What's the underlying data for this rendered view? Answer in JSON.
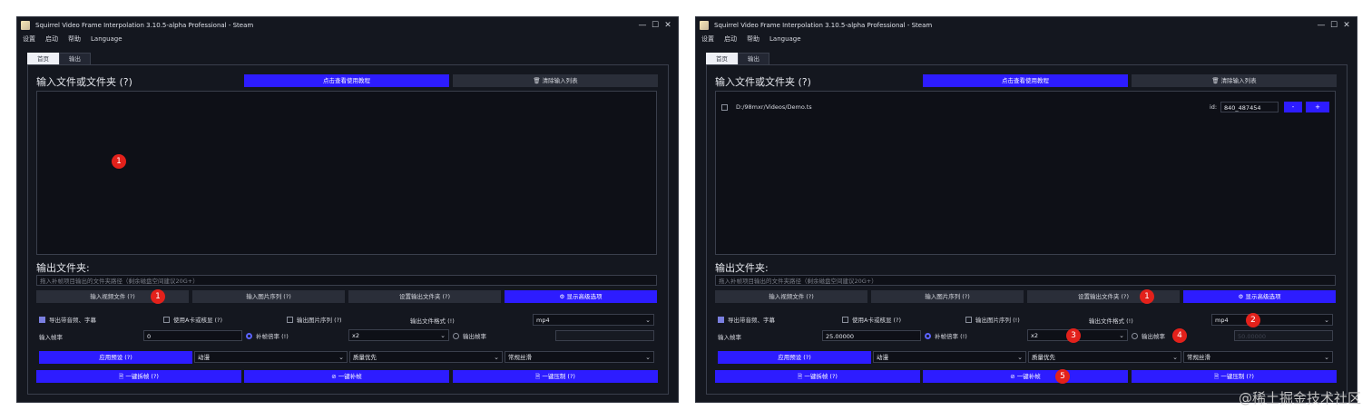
{
  "left": {
    "title": "Squirrel Video Frame Interpolation 3.10.5-alpha Professional - Steam",
    "window_controls": {
      "min": "—",
      "max": "☐",
      "close": "✕"
    },
    "menu": [
      "设置",
      "启动",
      "帮助",
      "Language"
    ],
    "tabs": [
      "首页",
      "输出"
    ],
    "input_heading": "输入文件或文件夹 (?)",
    "tutorial_button": "点击查看使用教程",
    "clear_button": "清除输入列表",
    "output_heading": "输出文件夹:",
    "output_placeholder": "拖入补帧项目输出的文件夹路径（剩余磁盘空间建议20G+）",
    "buttons_row": [
      "输入视频文件 (?)",
      "输入图片序列 (?)",
      "设置输出文件夹 (?)",
      "显示高级选项"
    ],
    "opt_audio": "导出带音频、字幕",
    "opt_acard": "使用A卡或核显 (?)",
    "opt_imgseq": "输出图片序列 (?)",
    "format_label": "输出文件格式 (!)",
    "format_value": "mp4",
    "fps_label": "输入帧率",
    "fps_value": "0",
    "ratio_label": "补帧倍率 (!)",
    "ratio_value": "x2",
    "outfps_label": "输出帧率",
    "outfps_value": "",
    "apply_preset": "应用预设 (?)",
    "preset_1": "动漫",
    "preset_2": "质量优先",
    "preset_3": "常规丝滑",
    "action_1": "一键拆帧 (?)",
    "action_2": "一键补帧",
    "action_3": "一键压制 (?)",
    "badges": [
      "1",
      "1"
    ]
  },
  "right": {
    "title": "Squirrel Video Frame Interpolation 3.10.5-alpha Professional - Steam",
    "window_controls": {
      "min": "—",
      "max": "☐",
      "close": "✕"
    },
    "menu": [
      "设置",
      "启动",
      "帮助",
      "Language"
    ],
    "tabs": [
      "首页",
      "输出"
    ],
    "input_heading": "输入文件或文件夹 (?)",
    "tutorial_button": "点击查看使用教程",
    "clear_button": "清除输入列表",
    "file_path": "D:/98mxr/Videos/Demo.ts",
    "id_label": "id:",
    "id_value": "840_487454",
    "minus": "-",
    "plus": "+",
    "output_heading": "输出文件夹:",
    "output_placeholder": "拖入补帧项目输出的文件夹路径（剩余磁盘空间建议20G+）",
    "buttons_row": [
      "输入视频文件 (?)",
      "输入图片序列 (?)",
      "设置输出文件夹 (?)",
      "显示高级选项"
    ],
    "opt_audio": "导出带音频、字幕",
    "opt_acard": "使用A卡或核显 (?)",
    "opt_imgseq": "输出图片序列 (!)",
    "format_label": "输出文件格式 (!)",
    "format_value": "mp4",
    "fps_label": "输入帧率",
    "fps_value": "25.00000",
    "ratio_label": "补帧倍率 (!)",
    "ratio_value": "x2",
    "outfps_label": "输出帧率",
    "outfps_value": "50.00000",
    "apply_preset": "应用预设 (?)",
    "preset_1": "动漫",
    "preset_2": "质量优先",
    "preset_3": "常规丝滑",
    "action_1": "一键拆帧 (?)",
    "action_2": "一键补帧",
    "action_3": "一键压制 (?)",
    "badges": [
      "1",
      "2",
      "3",
      "4",
      "5"
    ]
  },
  "watermark": "@稀土掘金技术社区",
  "colors": {
    "accent": "#2d1cff",
    "background": "#14171f",
    "badge": "#e3211b"
  },
  "icons": [
    "app-icon",
    "trash-icon",
    "gear-icon",
    "document-icon",
    "check-circle-icon"
  ]
}
